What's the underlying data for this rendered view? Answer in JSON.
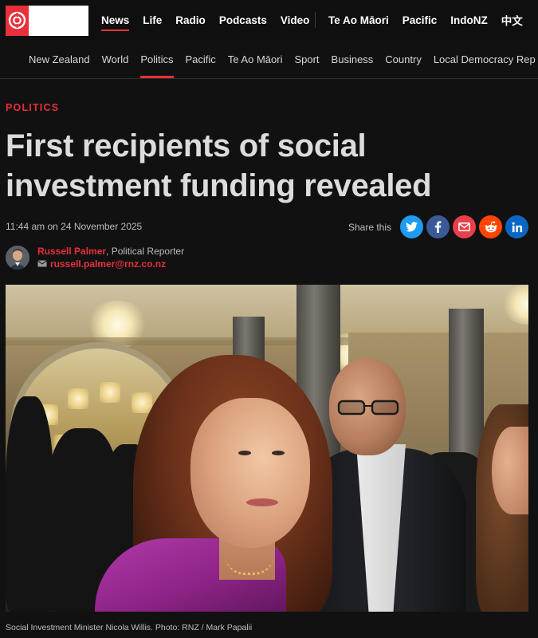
{
  "colors": {
    "accent": "#e8303a",
    "background": "#111111",
    "headline": "#dcdcdc",
    "twitter": "#1d9bf0",
    "facebook": "#3b5998",
    "email": "#e8404b",
    "reddit": "#ff4500",
    "linkedin": "#0a66c2"
  },
  "topnav": {
    "logo_icon": "rnz-logo-icon",
    "primary": [
      {
        "label": "News",
        "active": true
      },
      {
        "label": "Life"
      },
      {
        "label": "Radio"
      },
      {
        "label": "Podcasts"
      },
      {
        "label": "Video"
      }
    ],
    "secondary": [
      {
        "label": "Te Ao Māori"
      },
      {
        "label": "Pacific"
      },
      {
        "label": "IndoNZ"
      },
      {
        "label": "中文"
      }
    ]
  },
  "secnav": {
    "items": [
      {
        "label": "New Zealand"
      },
      {
        "label": "World"
      },
      {
        "label": "Politics",
        "active": true
      },
      {
        "label": "Pacific"
      },
      {
        "label": "Te Ao Māori"
      },
      {
        "label": "Sport"
      },
      {
        "label": "Business"
      },
      {
        "label": "Country"
      },
      {
        "label": "Local Democracy Rep"
      }
    ]
  },
  "article": {
    "kicker": "POLITICS",
    "headline_line1": "First recipients of social",
    "headline_line2": "investment funding revealed",
    "timestamp": "11:44 am on 24 November 2025",
    "share_label": "Share this",
    "share_buttons": [
      "twitter-icon",
      "facebook-icon",
      "email-icon",
      "reddit-icon",
      "linkedin-icon"
    ],
    "author": {
      "name": "Russell Palmer",
      "role": ", Political Reporter",
      "email": "russell.palmer@rnz.co.nz"
    },
    "caption": "Social Investment Minister Nicola Willis. Photo: RNZ / Mark Papalii"
  }
}
